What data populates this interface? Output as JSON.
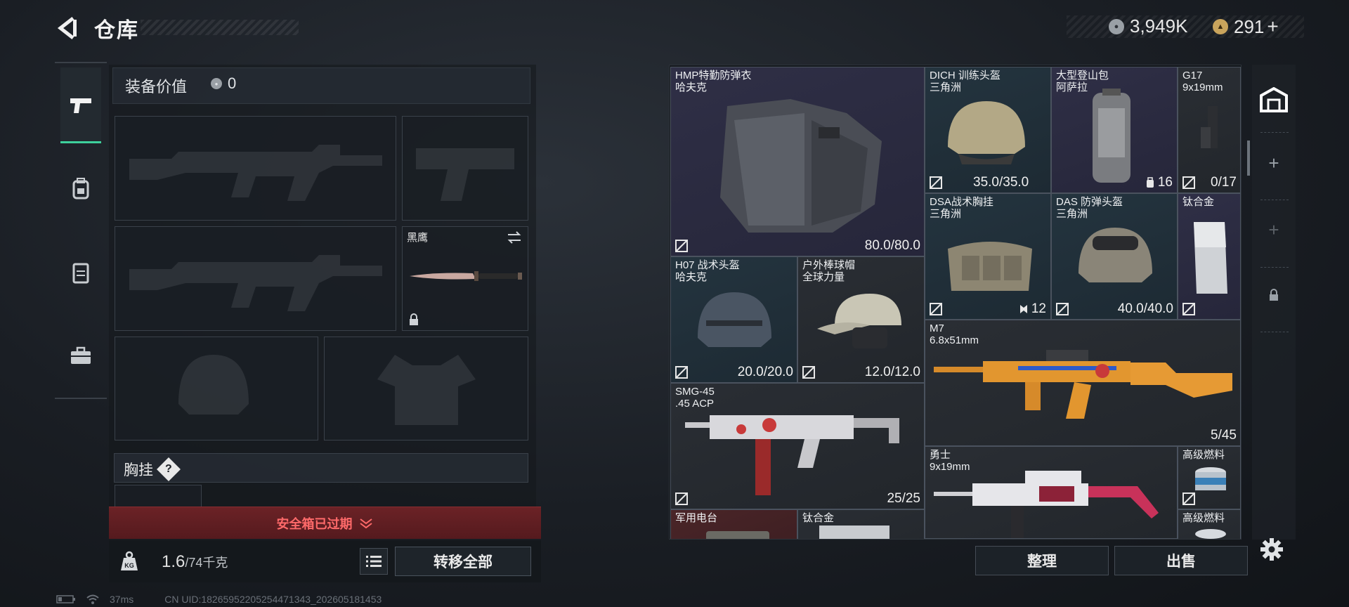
{
  "header": {
    "back_icon": "back-arrow-icon",
    "title": "仓库",
    "currency": [
      {
        "icon": "coin-icon",
        "value": "3,949K",
        "color": "#b9bec4"
      },
      {
        "icon": "gold-coin-icon",
        "value": "291",
        "suffix": "+",
        "color": "#d8b26a"
      }
    ]
  },
  "left_rail": {
    "items": [
      {
        "icon": "pistol-icon",
        "active": true
      },
      {
        "icon": "backpack-icon",
        "active": false
      },
      {
        "icon": "vest-icon",
        "active": false
      },
      {
        "icon": "toolbox-icon",
        "active": false
      }
    ]
  },
  "equipment": {
    "value_label": "装备价值",
    "value": "0",
    "melee": {
      "name": "黑鹰",
      "swap_icon": "swap-icon",
      "lock_icon": "lock-icon"
    },
    "chest_rig_label": "胸挂",
    "chest_help": "?",
    "safe_box_status": "安全箱已过期",
    "weight_current": "1.6",
    "weight_max": "/74千克",
    "transfer_all": "转移全部"
  },
  "storage": {
    "items": [
      {
        "name": "HMP特勤防弹衣",
        "sub": "哈夫克",
        "stat": "80.0/80.0",
        "rarity": "purple"
      },
      {
        "name": "DICH 训练头盔",
        "sub": "三角洲",
        "stat": "35.0/35.0",
        "rarity": "blue"
      },
      {
        "name": "大型登山包",
        "sub": "阿萨拉",
        "stat": "16",
        "rarity": "purple"
      },
      {
        "name": "G17",
        "sub": "9x19mm",
        "stat": "0/17",
        "rarity": "gray"
      },
      {
        "name": "DSA战术胸挂",
        "sub": "三角洲",
        "stat": "12",
        "rarity": "blue"
      },
      {
        "name": "DAS 防弹头盔",
        "sub": "三角洲",
        "stat": "40.0/40.0",
        "rarity": "blue"
      },
      {
        "name": "钛合金",
        "sub": "",
        "stat": "",
        "rarity": "purple"
      },
      {
        "name": "H07 战术头盔",
        "sub": "哈夫克",
        "stat": "20.0/20.0",
        "rarity": "blue"
      },
      {
        "name": "户外棒球帽",
        "sub": "全球力量",
        "stat": "12.0/12.0",
        "rarity": "gray"
      },
      {
        "name": "M7",
        "sub": "6.8x51mm",
        "stat": "5/45",
        "rarity": "gray"
      },
      {
        "name": "SMG-45",
        "sub": ".45 ACP",
        "stat": "25/25",
        "rarity": "gray"
      },
      {
        "name": "勇士",
        "sub": "9x19mm",
        "stat": "",
        "rarity": "gray"
      },
      {
        "name": "高级燃料",
        "sub": "",
        "stat": "",
        "rarity": "gray"
      },
      {
        "name": "军用电台",
        "sub": "",
        "stat": "",
        "rarity": "red"
      },
      {
        "name": "钛合金",
        "sub": "",
        "stat": "",
        "rarity": "gray"
      },
      {
        "name": "高级燃料",
        "sub": "",
        "stat": "",
        "rarity": "gray"
      }
    ],
    "sort_label": "整理",
    "sell_label": "出售"
  },
  "right_rail": {
    "items": [
      {
        "icon": "warehouse-icon"
      },
      {
        "icon": "plus-icon"
      },
      {
        "icon": "plus-icon"
      },
      {
        "icon": "lock-icon"
      }
    ],
    "settings_icon": "gear-icon"
  },
  "status": {
    "ping": "37ms",
    "uid": "CN UID:18265952205254471343_202605181453"
  }
}
